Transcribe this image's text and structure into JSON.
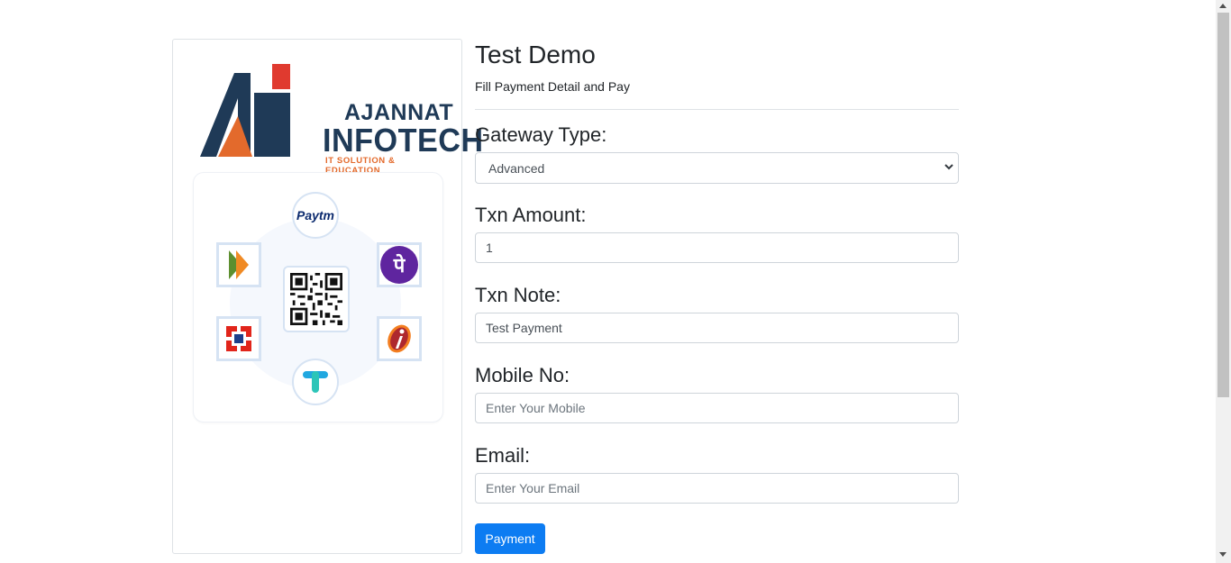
{
  "logo": {
    "line1": "AJANNAT",
    "line2": "INFOTECH",
    "tagline": "IT SOLUTION & EDUCATION"
  },
  "upi_graphic": {
    "paytm_label": "Paytm",
    "phonepe_glyph": "पे"
  },
  "header": {
    "title": "Test Demo",
    "subtitle": "Fill Payment Detail and Pay"
  },
  "form": {
    "gateway": {
      "label": "Gateway Type:",
      "selected": "Advanced"
    },
    "amount": {
      "label": "Txn Amount:",
      "value": "1"
    },
    "note": {
      "label": "Txn Note:",
      "value": "Test Payment"
    },
    "mobile": {
      "label": "Mobile No:",
      "placeholder": "Enter Your Mobile"
    },
    "email": {
      "label": "Email:",
      "placeholder": "Enter Your Email"
    },
    "submit_label": "Payment"
  },
  "colors": {
    "primary": "#0d7cf2",
    "brand_navy": "#1f3a57",
    "brand_orange": "#e36a2c"
  }
}
